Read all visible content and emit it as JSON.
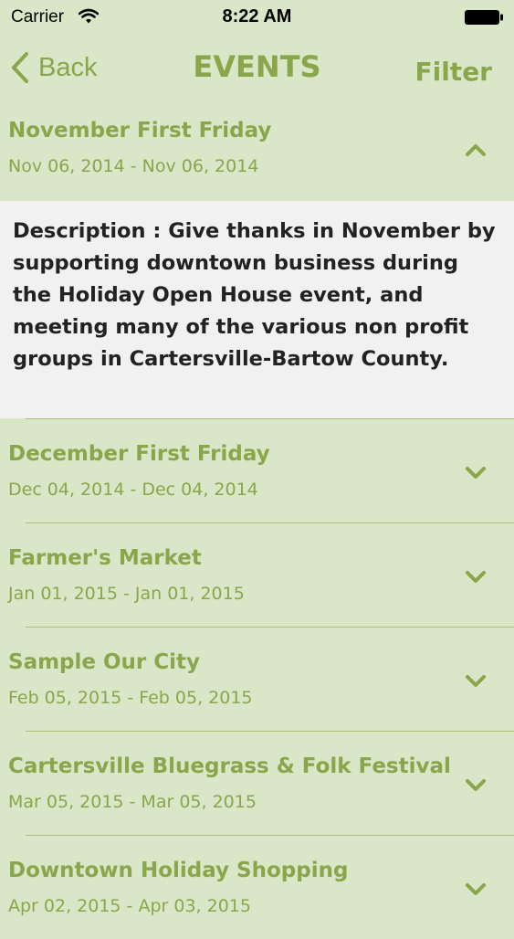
{
  "status_bar": {
    "carrier": "Carrier",
    "time": "8:22 AM"
  },
  "nav": {
    "back_label": "Back",
    "title": "EVENTS",
    "filter_label": "Filter"
  },
  "expanded_event": {
    "title": "November First Friday",
    "dates": "Nov 06, 2014 - Nov 06, 2014",
    "description": "Description : Give thanks in November by supporting downtown business during the Holiday Open House event, and meeting many of the various non profit groups in Cartersville-Bartow County."
  },
  "events": [
    {
      "title": "December First Friday",
      "dates": "Dec 04, 2014 - Dec 04, 2014"
    },
    {
      "title": "Farmer's Market",
      "dates": "Jan 01, 2015 - Jan 01, 2015"
    },
    {
      "title": "Sample Our City",
      "dates": "Feb 05, 2015 - Feb 05, 2015"
    },
    {
      "title": "Cartersville Bluegrass & Folk Festival",
      "dates": "Mar 05, 2015 - Mar 05, 2015"
    },
    {
      "title": "Downtown Holiday Shopping",
      "dates": "Apr 02, 2015 - Apr 03, 2015"
    }
  ],
  "colors": {
    "accent": "#8aa64b",
    "background": "#d9e6c7",
    "description_bg": "#f1f1f1"
  },
  "icons": {
    "wifi": "wifi-icon",
    "battery": "battery-icon",
    "back": "back-chevron-icon",
    "expanded": "chevron-up-icon",
    "collapsed": "chevron-down-icon"
  }
}
